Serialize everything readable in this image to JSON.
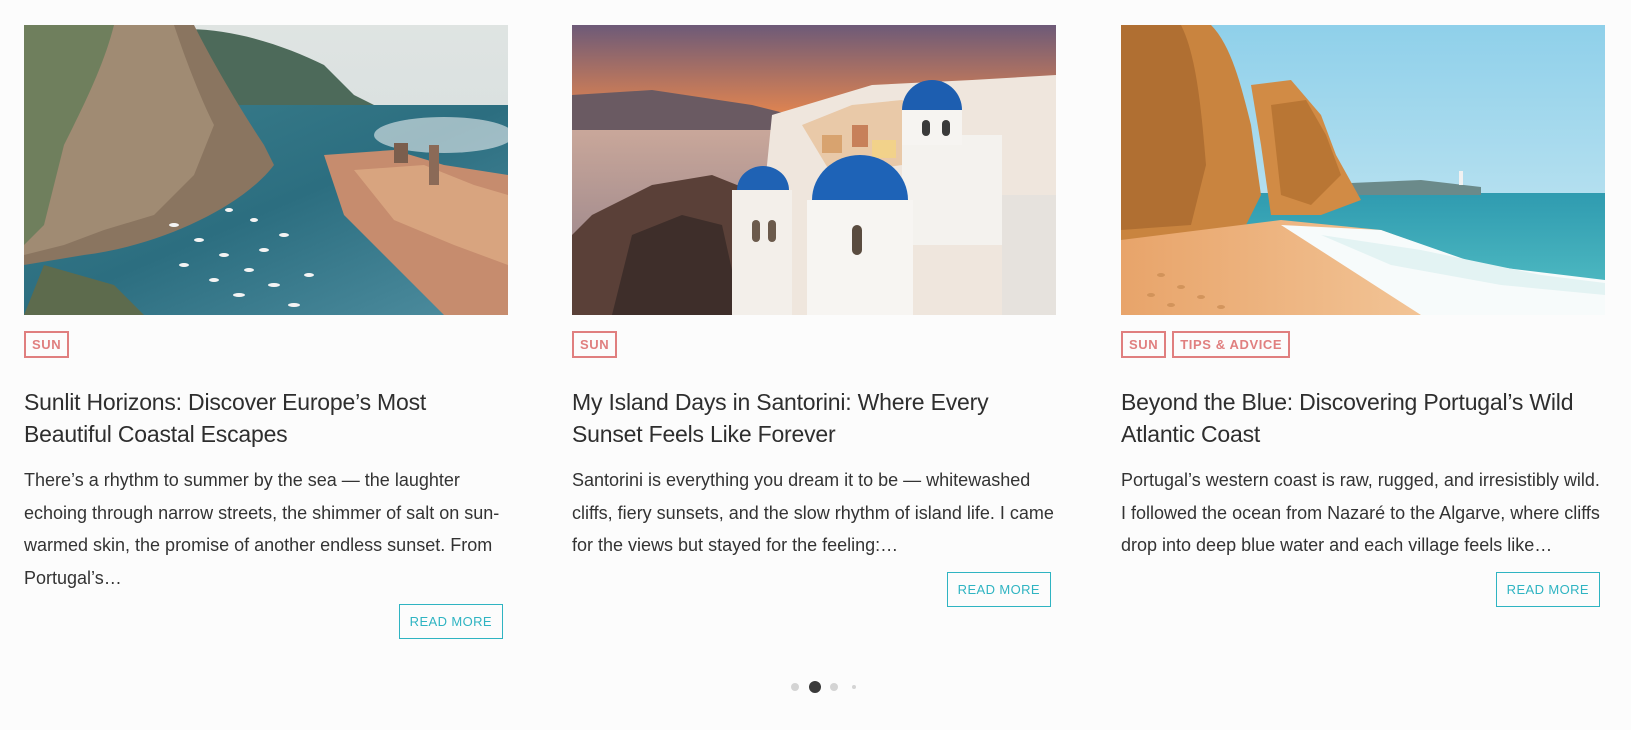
{
  "cards": [
    {
      "tags": [
        "SUN"
      ],
      "title": "Sunlit Horizons: Discover Europe’s Most Beautiful Coastal Escapes",
      "excerpt": "There’s a rhythm to summer by the sea — the laughter echoing through narrow streets, the shimmer of salt on sun-warmed skin, the promise of another endless sunset. From Portugal’s…",
      "read_more": "READ MORE",
      "image_alt": "Coastal cliffs and harbor village with boats"
    },
    {
      "tags": [
        "SUN"
      ],
      "title": "My Island Days in Santorini: Where Every Sunset Feels Like Forever",
      "excerpt": "Santorini is everything you dream it to be — whitewashed cliffs, fiery sunsets, and the slow rhythm of island life. I came for the views but stayed for the feeling:…",
      "read_more": "READ MORE",
      "image_alt": "Santorini blue domes at sunset"
    },
    {
      "tags": [
        "SUN",
        "TIPS & ADVICE"
      ],
      "title": "Beyond the Blue: Discovering Portugal’s Wild Atlantic Coast",
      "excerpt": "Portugal’s western coast is raw, rugged, and irresistibly wild. I followed the ocean from Nazaré to the Algarve, where cliffs drop into deep blue water and each village feels like…",
      "read_more": "READ MORE",
      "image_alt": "Golden cliffs and beach on the Atlantic coast"
    }
  ],
  "pagination": {
    "pages": 4,
    "active_index": 1
  },
  "colors": {
    "tag": "#e07f7f",
    "read_more": "#2fb4c2",
    "dot_active": "#3a3a3a",
    "dot_inactive": "#d4d4d4"
  }
}
